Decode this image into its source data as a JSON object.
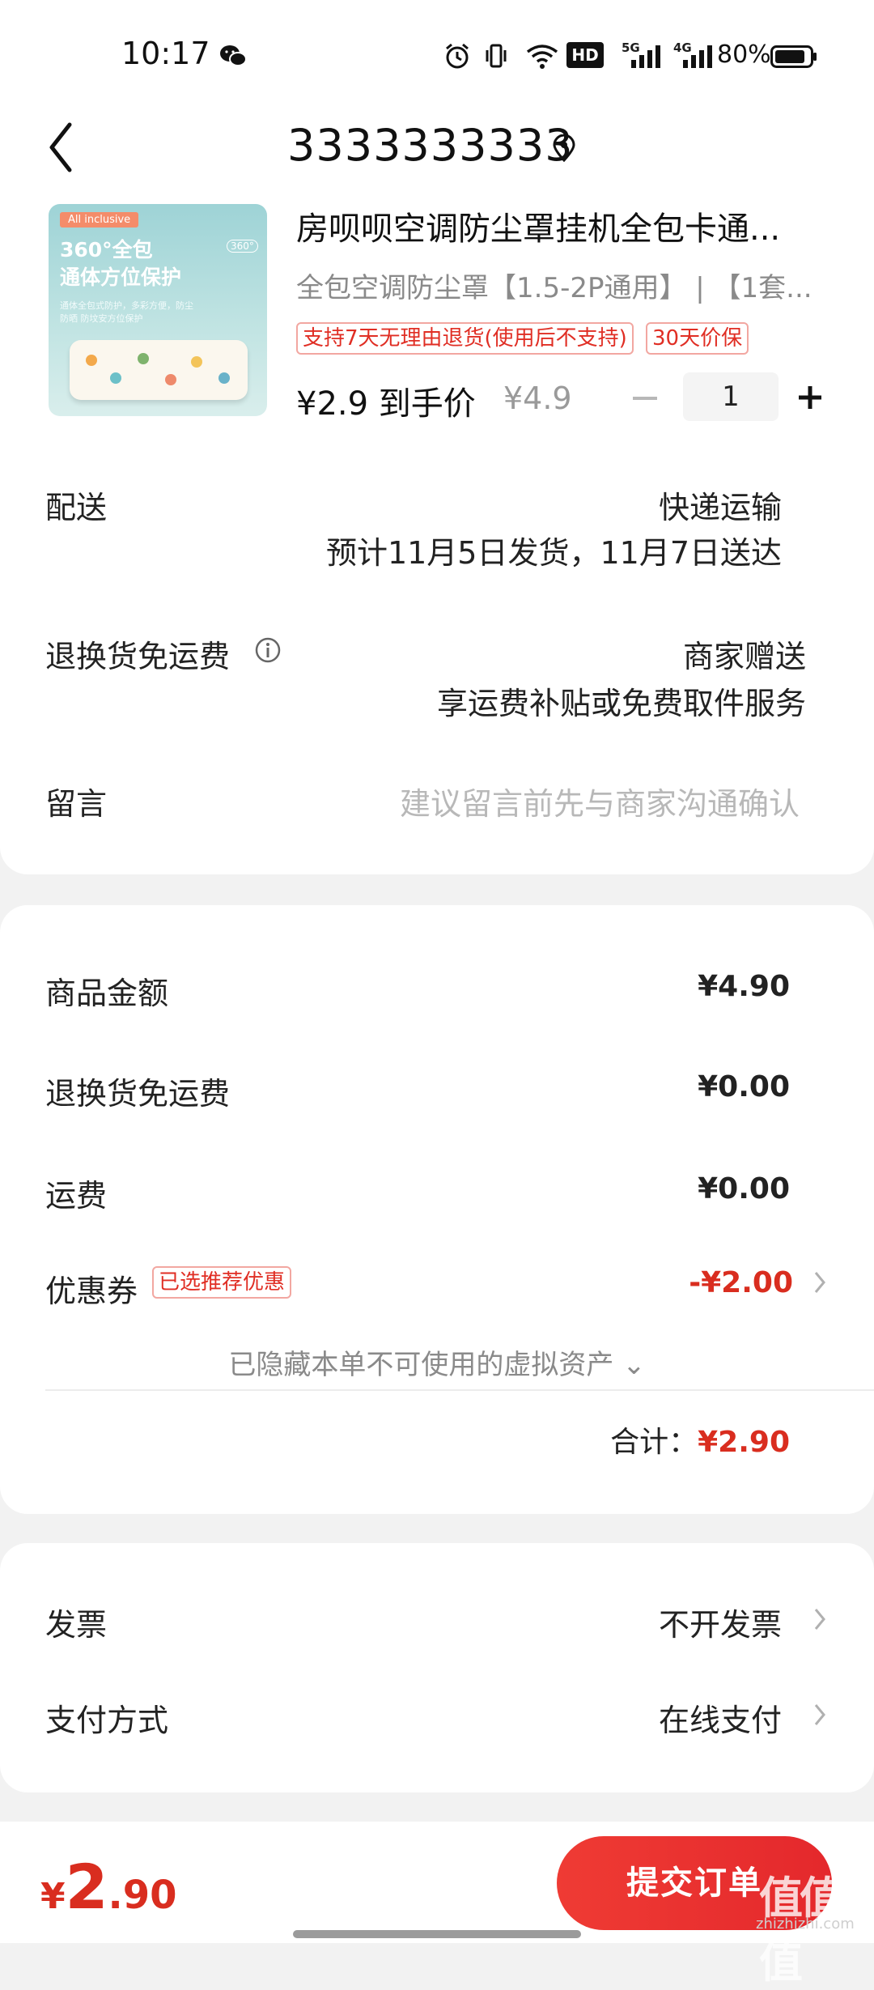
{
  "status_bar": {
    "time": "10:17",
    "network_5g": "5G",
    "network_4g": "4G",
    "hd": "HD",
    "battery": "80%"
  },
  "header": {
    "title": "3333333333"
  },
  "product": {
    "image_badge": "All inclusive",
    "image_line1": "360°全包",
    "image_line2": "通体方位保护",
    "image_small": "通体全包式防护，多彩方便，防尘防晒 防坟安方位保护",
    "image_360": "360°",
    "title": "房呗呗空调防尘罩挂机全包卡通...",
    "spec": "全包空调防尘罩【1.5-2P通用】 | 【1套...",
    "tag_return": "支持7天无理由退货(使用后不支持)",
    "tag_price_protect": "30天价保",
    "final_price": "¥2.9 到手价",
    "original_price": "¥4.9",
    "quantity": "1"
  },
  "delivery": {
    "label": "配送",
    "method": "快递运输",
    "estimate": "预计11月5日发货，11月7日送达"
  },
  "return_freight": {
    "label": "退换货免运费",
    "gift": "商家赠送",
    "service": "享运费补贴或免费取件服务"
  },
  "message": {
    "label": "留言",
    "placeholder": "建议留言前先与商家沟通确认"
  },
  "summary": {
    "goods_label": "商品金额",
    "goods_value": "¥4.90",
    "return_freight_label": "退换货免运费",
    "return_freight_value": "¥0.00",
    "shipping_label": "运费",
    "shipping_value": "¥0.00",
    "coupon_label": "优惠券",
    "coupon_tag": "已选推荐优惠",
    "coupon_value": "-¥2.00",
    "hidden_assets": "已隐藏本单不可使用的虚拟资产 ⌄",
    "total_label": "合计：",
    "total_value": "¥2.90"
  },
  "invoice": {
    "label": "发票",
    "value": "不开发票"
  },
  "payment": {
    "label": "支付方式",
    "value": "在线支付"
  },
  "bottom": {
    "currency": "¥",
    "amount_int": "2",
    "amount_dec": ".90",
    "submit": "提交订单",
    "watermark": "值值值",
    "watermark_url": "zhizhizhi.com"
  },
  "colors": {
    "accent_red": "#e02e24",
    "price_red": "#d92d1f",
    "button_red": "#ef3b34",
    "background": "#f2f2f2"
  }
}
